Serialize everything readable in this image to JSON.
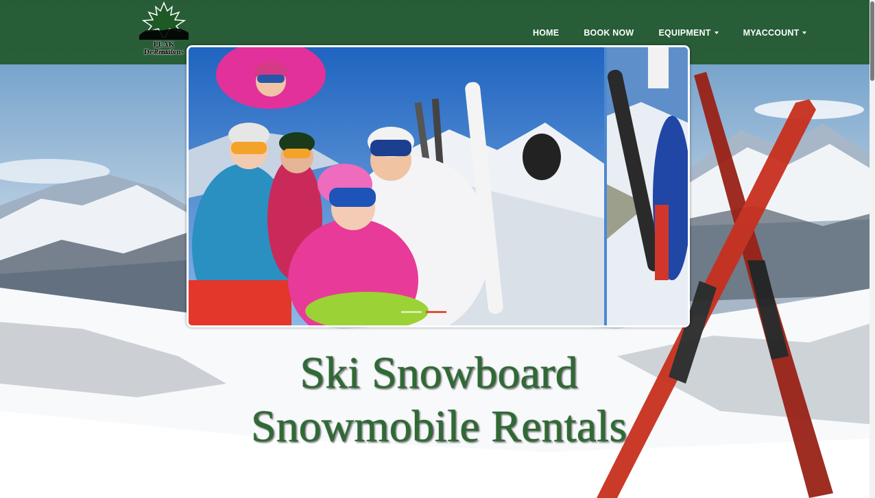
{
  "brand": {
    "logo_line1": "PEAK",
    "logo_line2": "Destinations",
    "logo_line3": "Rentals"
  },
  "nav": {
    "items": [
      {
        "label": "HOME",
        "dropdown": false
      },
      {
        "label": "BOOK NOW",
        "dropdown": false
      },
      {
        "label": "EQUIPMENT",
        "dropdown": true
      },
      {
        "label": "MYACCOUNT",
        "dropdown": true
      }
    ]
  },
  "hero": {
    "line1": "Ski Snowboard",
    "line2": "Snowmobile Rentals"
  },
  "slider": {
    "slide_count": 3,
    "active_index": 1
  },
  "colors": {
    "navbar": "#22582c",
    "headline": "#2e6b33",
    "dot_active": "#e0503a"
  }
}
